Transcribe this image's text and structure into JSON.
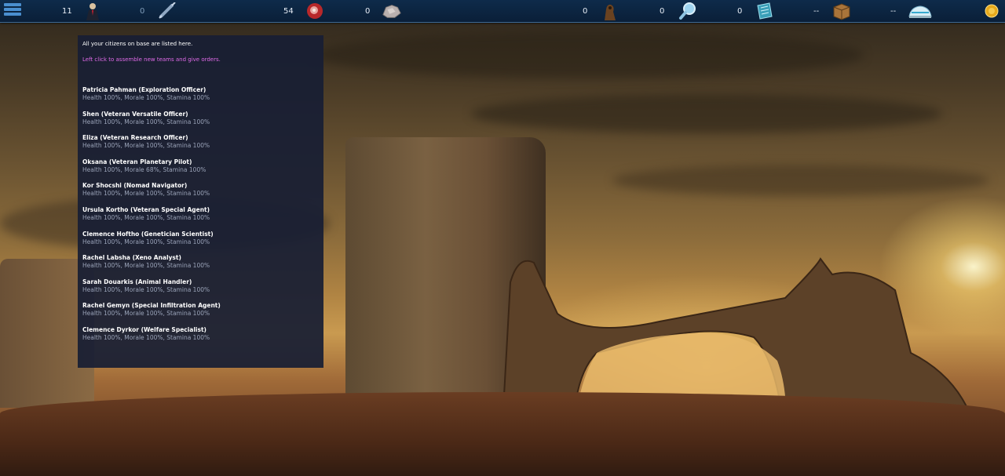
{
  "topbar": {
    "resources": [
      {
        "id": "agents",
        "value": "11",
        "icon": "agent-icon"
      },
      {
        "id": "syringes",
        "value": "0",
        "icon": "syringe-icon"
      },
      {
        "id": "food",
        "value": "54",
        "icon": "meat-icon"
      },
      {
        "id": "ore",
        "value": "0",
        "icon": "ore-icon"
      },
      {
        "id": "creatures",
        "value": "0",
        "icon": "creature-icon"
      },
      {
        "id": "research",
        "value": "0",
        "icon": "magnifier-icon"
      },
      {
        "id": "data",
        "value": "0",
        "icon": "data-pad-icon"
      },
      {
        "id": "crates",
        "value": "--",
        "icon": "crate-icon"
      },
      {
        "id": "habitats",
        "value": "--",
        "icon": "habitat-dome-icon"
      }
    ],
    "icons": {
      "menu": "menu-icon",
      "coin": "coin-icon"
    }
  },
  "panel": {
    "intro": "All your citizens on base are listed here.",
    "hint": "Left click to assemble new teams and give orders.",
    "citizens": [
      {
        "name": "Patricia Pahman (Exploration Officer)",
        "stats": "Health 100%, Morale 100%, Stamina 100%"
      },
      {
        "name": "Shen (Veteran Versatile Officer)",
        "stats": "Health 100%, Morale 100%, Stamina 100%"
      },
      {
        "name": "Eliza (Veteran Research Officer)",
        "stats": "Health 100%, Morale 100%, Stamina 100%"
      },
      {
        "name": "Oksana (Veteran Planetary Pilot)",
        "stats": "Health 100%, Morale 68%, Stamina 100%"
      },
      {
        "name": "Kor Shocshi (Nomad Navigator)",
        "stats": "Health 100%, Morale 100%, Stamina 100%"
      },
      {
        "name": "Ursula Kortho (Veteran Special Agent)",
        "stats": "Health 100%, Morale 100%, Stamina 100%"
      },
      {
        "name": "Clemence Hoftho (Genetician Scientist)",
        "stats": "Health 100%, Morale 100%, Stamina 100%"
      },
      {
        "name": "Rachel Labsha (Xeno Analyst)",
        "stats": "Health 100%, Morale 100%, Stamina 100%"
      },
      {
        "name": "Sarah Douarkis (Animal Handler)",
        "stats": "Health 100%, Morale 100%, Stamina 100%"
      },
      {
        "name": "Rachel Gemyn (Special Infiltration Agent)",
        "stats": "Health 100%, Morale 100%, Stamina 100%"
      },
      {
        "name": "Clemence Dyrkor (Welfare Specialist)",
        "stats": "Health 100%, Morale 100%, Stamina 100%"
      }
    ]
  },
  "colors": {
    "topbar": "#0e2b4a",
    "panel": "#181e34",
    "hint": "#e06be8",
    "stats": "#9aa3b8"
  }
}
